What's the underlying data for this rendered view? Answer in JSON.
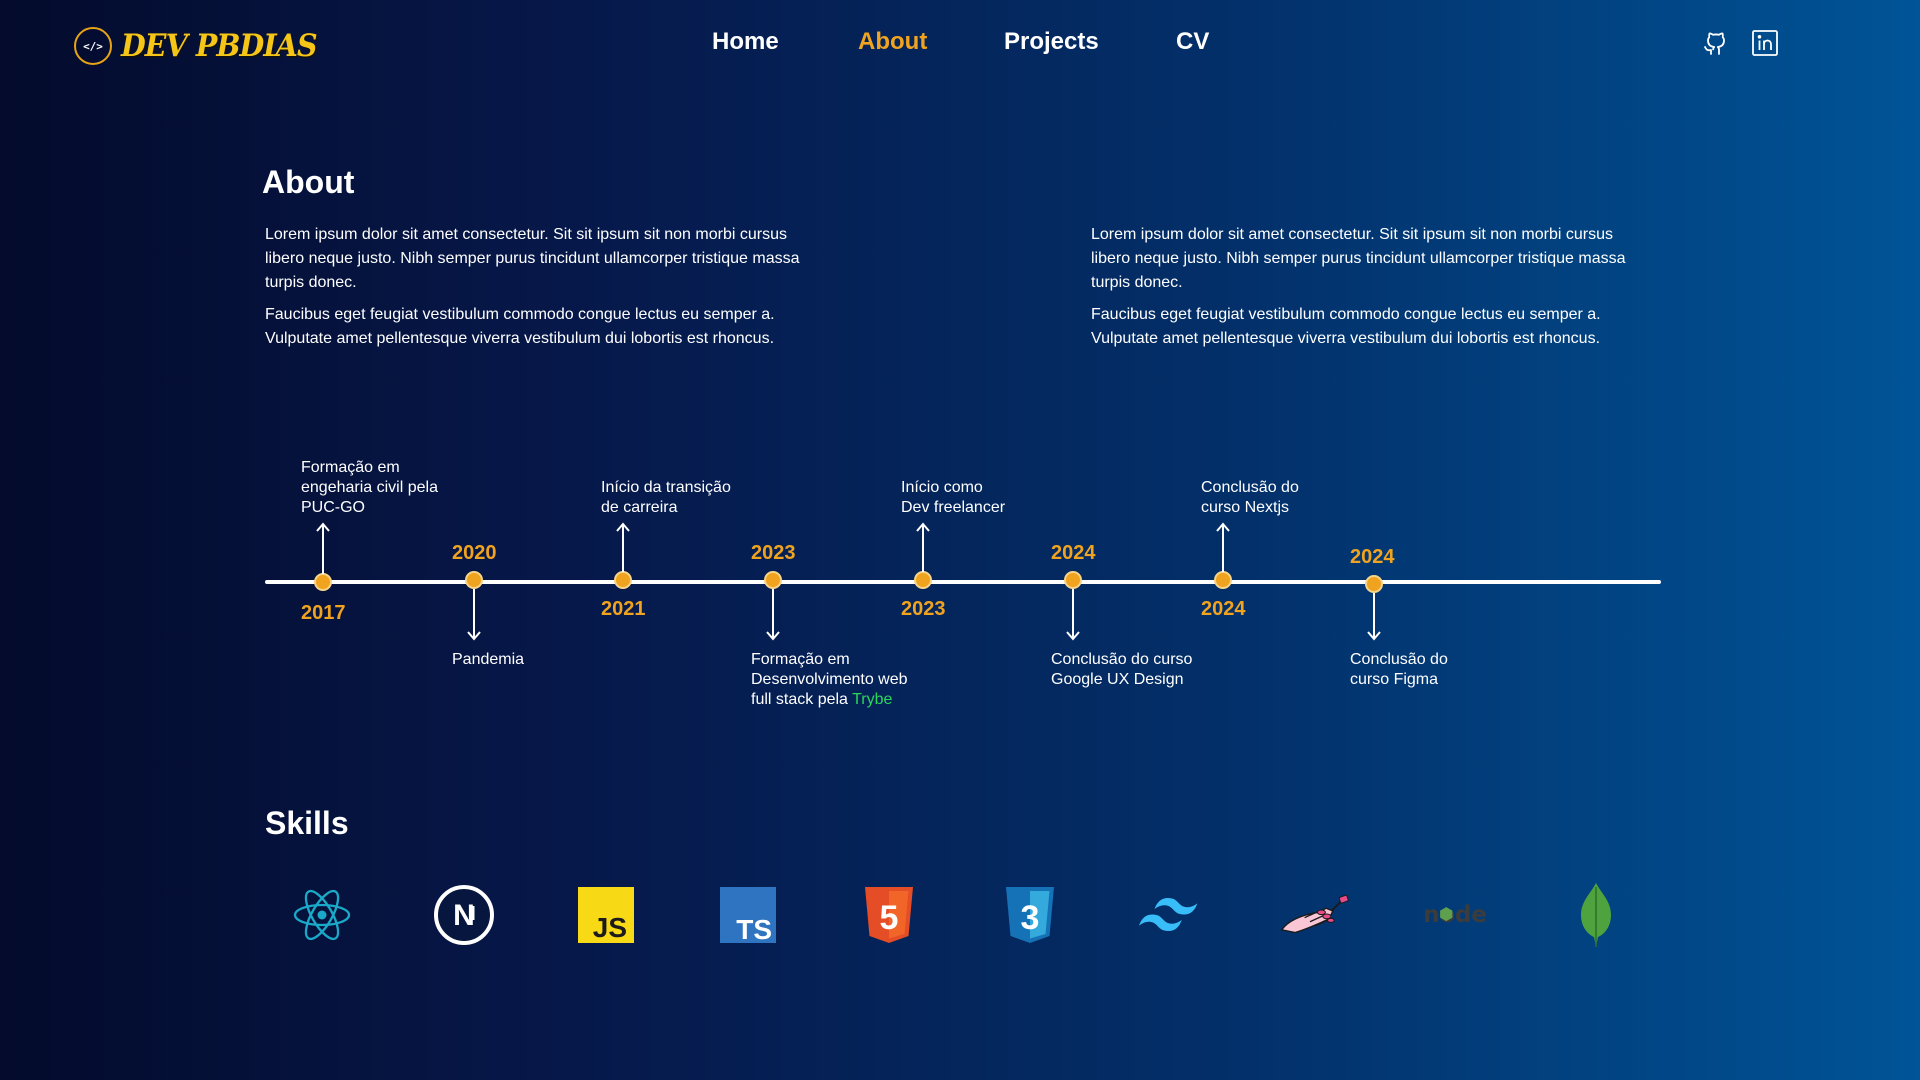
{
  "header": {
    "logo_glyph": "</>",
    "logo_text": "DEV PBDIAS",
    "nav": [
      "Home",
      "About",
      "Projects",
      "CV"
    ],
    "active_nav": "About",
    "social": [
      "github-icon",
      "linkedin-icon"
    ]
  },
  "about": {
    "title": "About",
    "left": {
      "p1": "Lorem ipsum dolor sit amet consectetur. Sit sit ipsum sit non morbi cursus libero neque justo. Nibh semper purus tincidunt ullamcorper tristique massa turpis donec.",
      "p2": "Faucibus eget feugiat vestibulum commodo congue lectus eu semper a. Vulputate amet pellentesque viverra vestibulum dui lobortis est rhoncus."
    },
    "right": {
      "p1": "Lorem ipsum dolor sit amet consectetur. Sit sit ipsum sit non morbi cursus libero neque justo. Nibh semper purus tincidunt ullamcorper tristique massa turpis donec.",
      "p2": "Faucibus eget feugiat vestibulum commodo congue lectus eu semper a. Vulputate amet pellentesque viverra vestibulum dui lobortis est rhoncus."
    }
  },
  "timeline": {
    "events": [
      {
        "year": "2017",
        "text": "Formação em\nengeharia civil pela\nPUC-GO"
      },
      {
        "year": "2020",
        "text": "Pandemia"
      },
      {
        "year": "2021",
        "text": "Início da transição\nde carreira"
      },
      {
        "year": "2023",
        "text": "Formação em\nDesenvolvimento web\nfull stack pela ",
        "highlight": "Trybe"
      },
      {
        "year": "2023",
        "text": "Início  como\nDev freelancer"
      },
      {
        "year": "2024",
        "text": "Conclusão do curso\nGoogle UX Design"
      },
      {
        "year": "2024",
        "text": "Conclusão do\ncurso Nextjs"
      },
      {
        "year": "2024",
        "text": "Conclusão do\ncurso Figma"
      }
    ]
  },
  "skills": {
    "title": "Skills",
    "items": [
      {
        "icon": "react-icon",
        "label": ""
      },
      {
        "icon": "nextjs-icon",
        "label": "N"
      },
      {
        "icon": "javascript-icon",
        "label": "JS"
      },
      {
        "icon": "typescript-icon",
        "label": "TS"
      },
      {
        "icon": "html5-icon",
        "label": "5"
      },
      {
        "icon": "css3-icon",
        "label": "3"
      },
      {
        "icon": "tailwind-icon",
        "label": ""
      },
      {
        "icon": "styled-components-icon",
        "label": ""
      },
      {
        "icon": "nodejs-icon",
        "label": "node"
      },
      {
        "icon": "mongodb-icon",
        "label": ""
      }
    ]
  },
  "colors": {
    "accent": "#f0a31f",
    "trybe_green": "#2bd65a",
    "bg_left": "#040b2c",
    "bg_right": "#005497"
  }
}
